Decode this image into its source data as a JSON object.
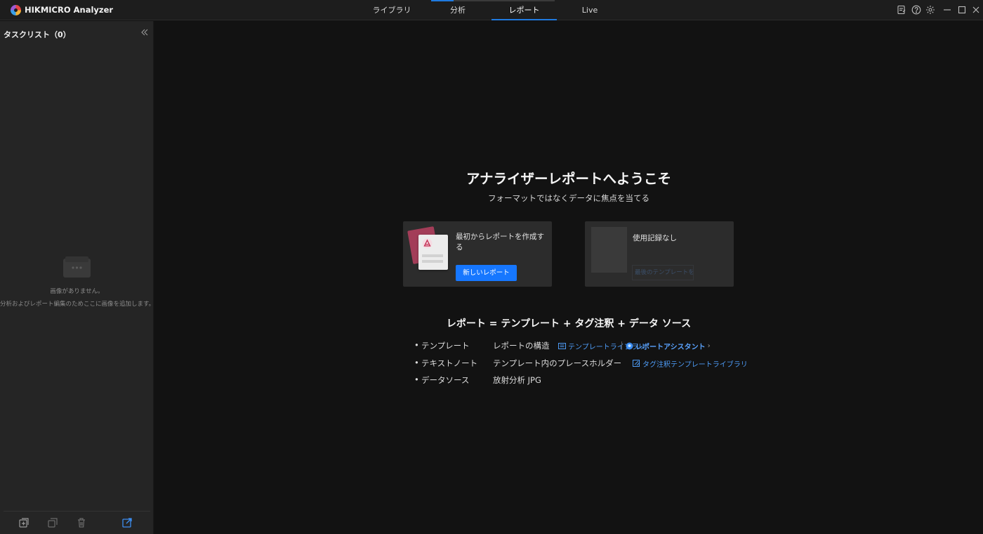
{
  "app": {
    "title": "HIKMICRO Analyzer",
    "tabs": [
      {
        "label": "ライブラリ"
      },
      {
        "label": "分析"
      },
      {
        "label": "レポート"
      },
      {
        "label": "Live"
      }
    ],
    "active_tab": "レポート",
    "accent_color": "#1f7ae0"
  },
  "sidebar": {
    "title": "タスクリスト（0）",
    "empty_title": "画像がありません。",
    "empty_desc": "分析およびレポート編集のためここに画像を追加します。",
    "bottom_icons": [
      "import-icon",
      "copy-icon",
      "delete-icon",
      "export-icon"
    ]
  },
  "main": {
    "welcome_title": "アナライザーレポートへようこそ",
    "welcome_subtitle": "フォーマットではなくデータに焦点を当てる",
    "new_card": {
      "text": "最初からレポートを作成する",
      "button": "新しいレポート"
    },
    "recent_card": {
      "text": "使用記録なし",
      "link": "最後のテンプレートを使..."
    },
    "formula": "レポート = テンプレート + タグ注釈 + データ ソース",
    "rows": [
      {
        "name": "テンプレート",
        "desc": "レポートの構造",
        "links": [
          "テンプレートライブラリ",
          "レポートアシスタント"
        ]
      },
      {
        "name": "テキストノート",
        "desc": "テンプレート内のプレースホルダー",
        "links": [
          "タグ注釈テンプレートライブラリ"
        ]
      },
      {
        "name": "データソース",
        "desc": "放射分析 JPG",
        "links": []
      }
    ]
  }
}
